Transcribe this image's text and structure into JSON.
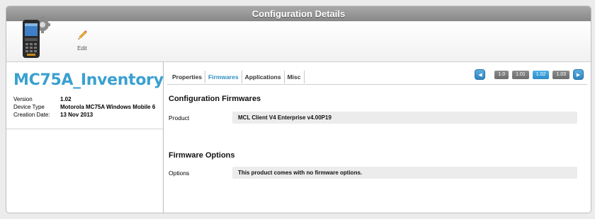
{
  "window": {
    "title": "Configuration Details"
  },
  "toolbar": {
    "device_icon": "handheld-device-gear-icon",
    "edit_icon": "pencil-icon",
    "edit_label": "Edit"
  },
  "config": {
    "name": "MC75A_Inventory",
    "info": [
      {
        "label": "Version",
        "value": "1.02"
      },
      {
        "label": "Device Type",
        "value": "Motorola MC75A Windows Mobile 6"
      },
      {
        "label": "Creation Date:",
        "value": "13 Nov 2013"
      }
    ]
  },
  "tabs": [
    {
      "label": "Properties",
      "active": false
    },
    {
      "label": "Firmwares",
      "active": true
    },
    {
      "label": "Applications",
      "active": false
    },
    {
      "label": "Misc",
      "active": false
    }
  ],
  "versions": {
    "prev_icon": "chevron-left-icon",
    "next_icon": "chevron-right-icon",
    "items": [
      "1.0",
      "1.01",
      "1.02",
      "1.03"
    ],
    "selected": "1.02"
  },
  "firmwares": {
    "section_title": "Configuration Firmwares",
    "product_label": "Product",
    "product_value": "MCL Client V4 Enterprise v4.00P19",
    "options_title": "Firmware Options",
    "options_label": "Options",
    "options_value": "This product comes with no firmware options."
  },
  "colors": {
    "accent": "#3ba0d0",
    "active_tab": "#2e8fc0",
    "version_selected": "#2b8cc8",
    "titlebar": "#969696"
  }
}
